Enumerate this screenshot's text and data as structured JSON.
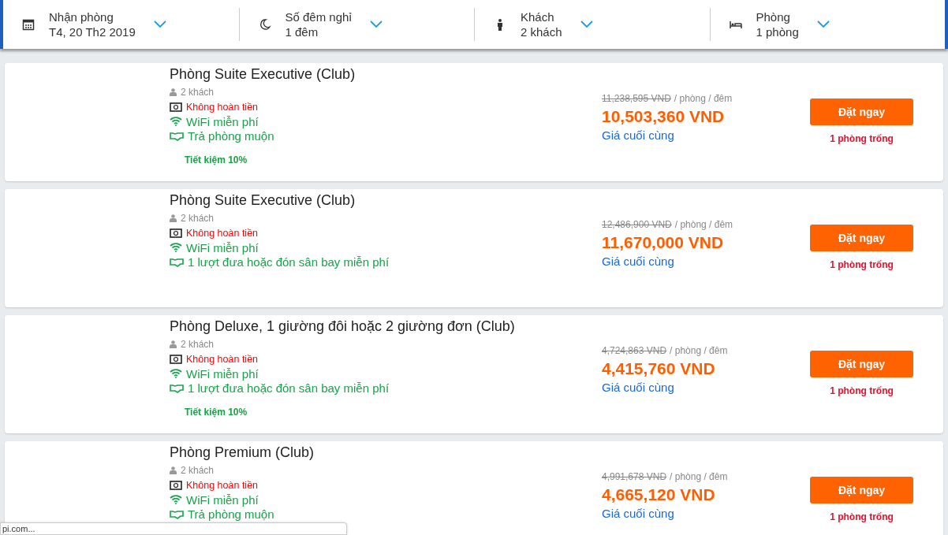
{
  "search_bar": {
    "fields": [
      {
        "kind": "calendar",
        "label": "Nhận phòng",
        "value": "T4, 20 Th2 2019"
      },
      {
        "kind": "moon",
        "label": "Số đêm nghỉ",
        "value": "1 đêm"
      },
      {
        "kind": "person",
        "label": "Khách",
        "value": "2 khách"
      },
      {
        "kind": "bed",
        "label": "Phòng",
        "value": "1 phòng"
      }
    ]
  },
  "rooms": [
    {
      "name": "Phòng Suite Executive (Club)",
      "guests": "2 khách",
      "features": [
        {
          "kind": "refund",
          "text": "Không hoàn tiền"
        },
        {
          "kind": "wifi",
          "text": "WiFi miễn phí"
        },
        {
          "kind": "service",
          "text": "Trả phòng muộn"
        }
      ],
      "savings": "Tiết kiệm 10%",
      "old_price": "11,238,595 VND",
      "unit": "/ phòng / đêm",
      "price": "10,503,360 VND",
      "price_note": "Giá cuối cùng",
      "button": "Đặt ngay",
      "availability": "1 phòng trống"
    },
    {
      "name": "Phòng Suite Executive (Club)",
      "guests": "2 khách",
      "features": [
        {
          "kind": "refund",
          "text": "Không hoàn tiền"
        },
        {
          "kind": "wifi",
          "text": "WiFi miễn phí"
        },
        {
          "kind": "service",
          "text": "1 lượt đưa hoặc đón sân bay miễn phí"
        }
      ],
      "old_price": "12,486,900 VND",
      "unit": "/ phòng / đêm",
      "price": "11,670,000 VND",
      "price_note": "Giá cuối cùng",
      "button": "Đặt ngay",
      "availability": "1 phòng trống"
    },
    {
      "name": "Phòng Deluxe, 1 giường đôi hoặc 2 giường đơn (Club)",
      "guests": "2 khách",
      "features": [
        {
          "kind": "refund",
          "text": "Không hoàn tiền"
        },
        {
          "kind": "wifi",
          "text": "WiFi miễn phí"
        },
        {
          "kind": "service",
          "text": "1 lượt đưa hoặc đón sân bay miễn phí"
        }
      ],
      "savings": "Tiết kiệm 10%",
      "old_price": "4,724,863 VND",
      "unit": "/ phòng / đêm",
      "price": "4,415,760 VND",
      "price_note": "Giá cuối cùng",
      "button": "Đặt ngay",
      "availability": "1 phòng trống"
    },
    {
      "name": "Phòng Premium (Club)",
      "guests": "2 khách",
      "features": [
        {
          "kind": "refund",
          "text": "Không hoàn tiền"
        },
        {
          "kind": "wifi",
          "text": "WiFi miễn phí"
        },
        {
          "kind": "service",
          "text": "Trả phòng muộn"
        }
      ],
      "old_price": "4,991,678 VND",
      "unit": "/ phòng / đêm",
      "price": "4,665,120 VND",
      "price_note": "Giá cuối cùng",
      "button": "Đặt ngay",
      "availability": "1 phòng trống"
    }
  ],
  "status_bar": {
    "url": "pi.com..."
  }
}
